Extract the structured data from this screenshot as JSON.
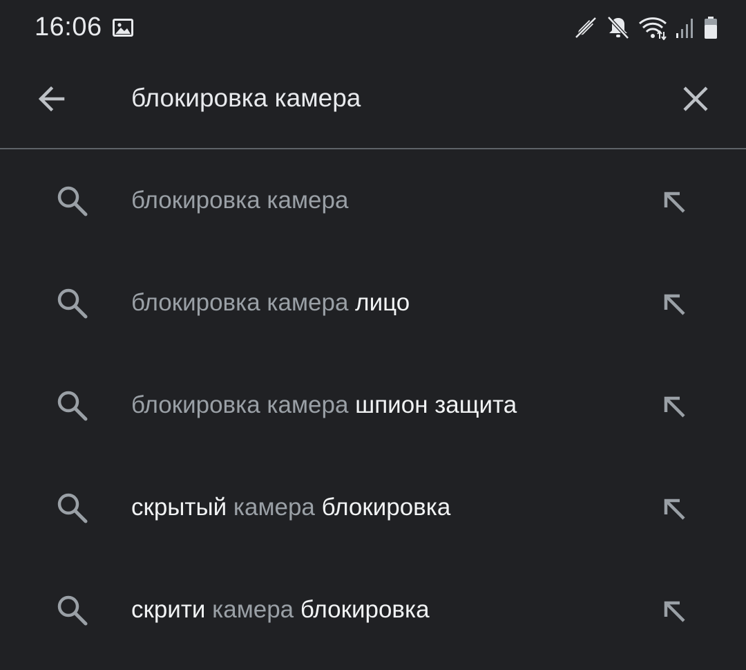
{
  "status_bar": {
    "time": "16:06",
    "icons": [
      "image-notification-icon",
      "edit-off-icon",
      "mute-icon",
      "wifi-icon",
      "signal-icon",
      "battery-icon"
    ]
  },
  "search": {
    "query": "блокировка камера",
    "back_icon": "arrow-back-icon",
    "clear_icon": "close-icon"
  },
  "suggestions": [
    {
      "segments": [
        {
          "text": "блокировка камера",
          "style": "dim"
        }
      ]
    },
    {
      "segments": [
        {
          "text": "блокировка камера",
          "style": "dim"
        },
        {
          "text": " лицо",
          "style": "bright"
        }
      ]
    },
    {
      "segments": [
        {
          "text": "блокировка камера",
          "style": "dim"
        },
        {
          "text": " шпион защита",
          "style": "bright"
        }
      ]
    },
    {
      "segments": [
        {
          "text": "скрытый",
          "style": "bright"
        },
        {
          "text": " камера",
          "style": "dim"
        },
        {
          "text": " блокировка",
          "style": "bright"
        }
      ]
    },
    {
      "segments": [
        {
          "text": "скрити",
          "style": "bright"
        },
        {
          "text": " камера",
          "style": "dim"
        },
        {
          "text": " блокировка",
          "style": "bright"
        }
      ]
    }
  ],
  "colors": {
    "background": "#202124",
    "text_bright": "#f1f3f4",
    "text_dim": "#9aa0a6",
    "icon": "#9aa0a6",
    "divider": "#5f6368"
  }
}
